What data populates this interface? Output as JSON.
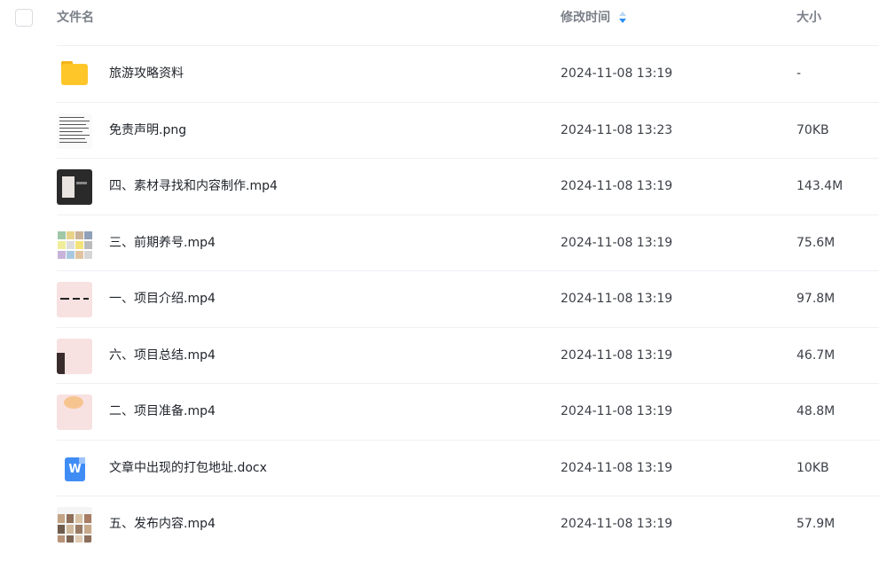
{
  "header": {
    "col_name": "文件名",
    "col_time": "修改时间",
    "col_size": "大小",
    "sort_icon": "sort-desc-icon"
  },
  "files": [
    {
      "name": "旅游攻略资料",
      "time": "2024-11-08 13:19",
      "size": "-",
      "icon": "folder-icon"
    },
    {
      "name": "免责声明.png",
      "time": "2024-11-08 13:23",
      "size": "70KB",
      "icon": "image-thumbnail"
    },
    {
      "name": "四、素材寻找和内容制作.mp4",
      "time": "2024-11-08 13:19",
      "size": "143.4M",
      "icon": "video-thumbnail"
    },
    {
      "name": "三、前期养号.mp4",
      "time": "2024-11-08 13:19",
      "size": "75.6M",
      "icon": "video-thumbnail"
    },
    {
      "name": "一、项目介绍.mp4",
      "time": "2024-11-08 13:19",
      "size": "97.8M",
      "icon": "video-thumbnail"
    },
    {
      "name": "六、项目总结.mp4",
      "time": "2024-11-08 13:19",
      "size": "46.7M",
      "icon": "video-thumbnail"
    },
    {
      "name": "二、项目准备.mp4",
      "time": "2024-11-08 13:19",
      "size": "48.8M",
      "icon": "video-thumbnail"
    },
    {
      "name": "文章中出现的打包地址.docx",
      "time": "2024-11-08 13:19",
      "size": "10KB",
      "icon": "word-doc-icon"
    },
    {
      "name": "五、发布内容.mp4",
      "time": "2024-11-08 13:19",
      "size": "57.9M",
      "icon": "video-thumbnail"
    }
  ],
  "word_icon_letter": "W",
  "colors": {
    "accent": "#2b8ef2",
    "folder": "#ffc62a",
    "word": "#3f8cf5"
  }
}
